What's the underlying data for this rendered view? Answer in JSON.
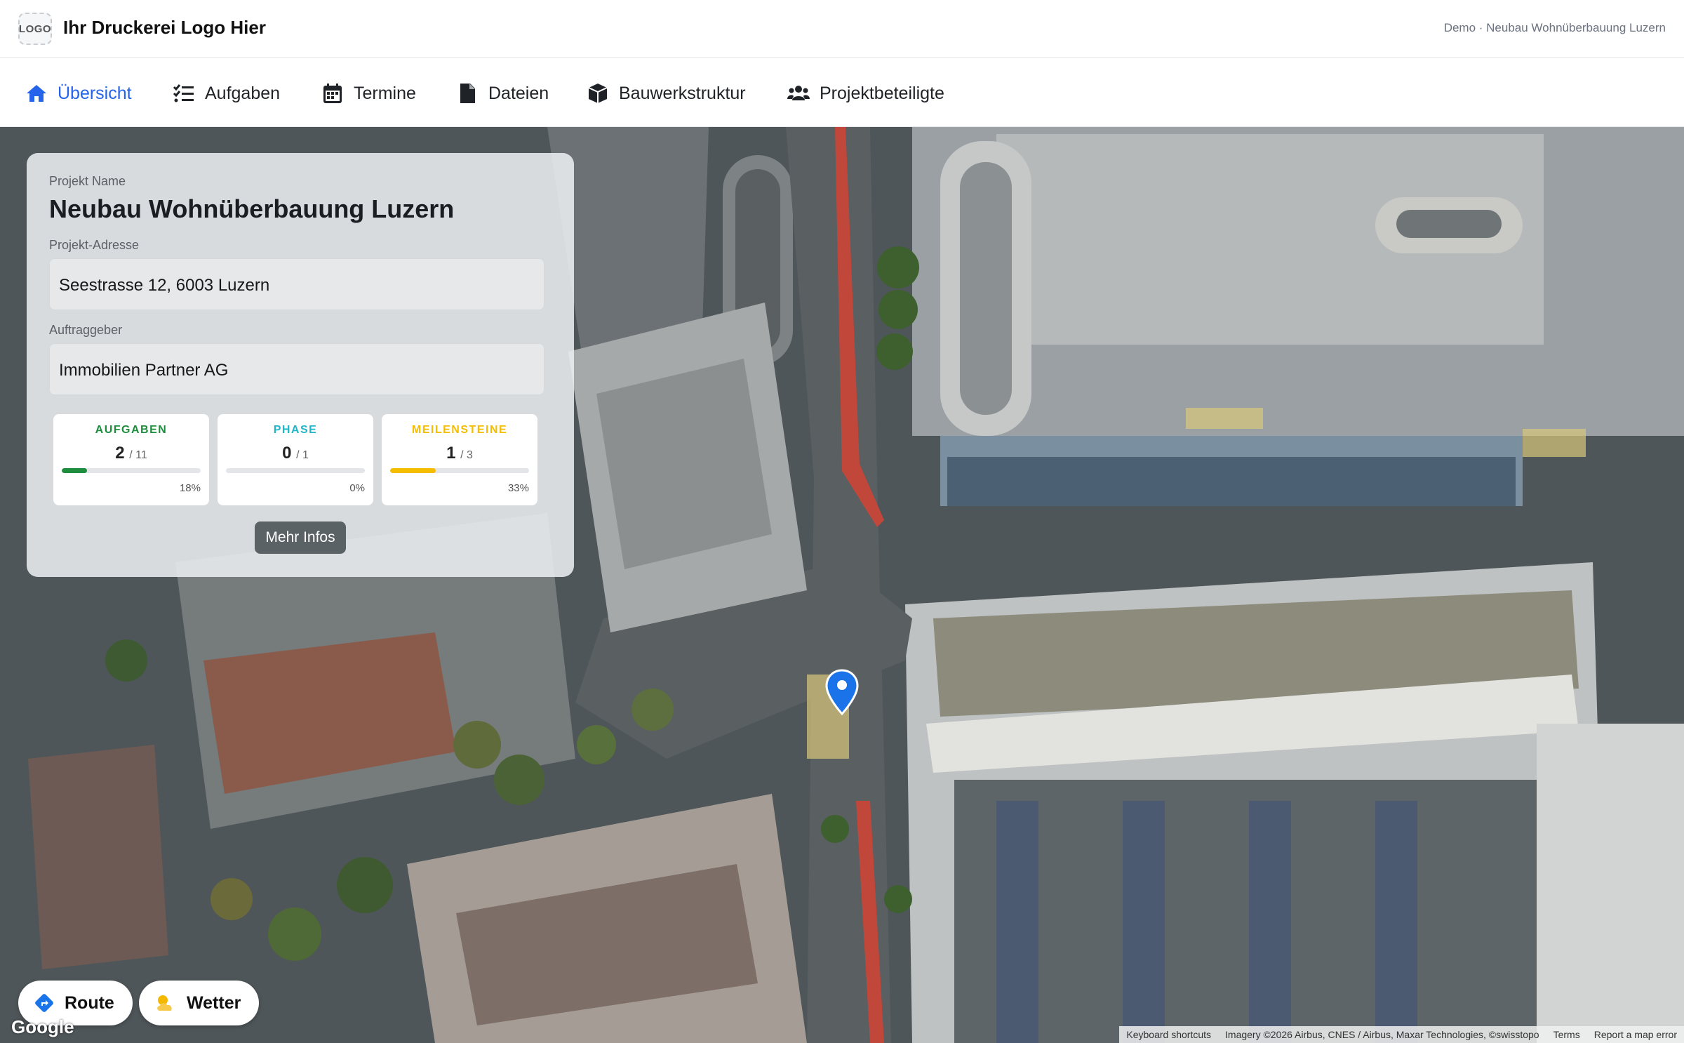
{
  "header": {
    "logo_text": "LOGO",
    "brand": "Ihr Druckerei Logo Hier",
    "context": "Demo · Neubau Wohnüberbauung Luzern"
  },
  "nav": {
    "items": [
      {
        "label": "Übersicht",
        "icon": "home-icon",
        "active": true
      },
      {
        "label": "Aufgaben",
        "icon": "task-list-icon"
      },
      {
        "label": "Termine",
        "icon": "calendar-icon"
      },
      {
        "label": "Dateien",
        "icon": "file-icon"
      },
      {
        "label": "Bauwerkstruktur",
        "icon": "cube-icon"
      },
      {
        "label": "Projektbeteiligte",
        "icon": "users-icon"
      }
    ]
  },
  "project": {
    "name_label": "Projekt Name",
    "name": "Neubau Wohnüberbauung Luzern",
    "address_label": "Projekt-Adresse",
    "address": "Seestrasse 12, 6003 Luzern",
    "client_label": "Auftraggeber",
    "client": "Immobilien Partner AG"
  },
  "stats": [
    {
      "title": "AUFGABEN",
      "value": "2",
      "total": "/ 11",
      "percent": "18%",
      "fraction": 0.18,
      "color": "#1e8e3e"
    },
    {
      "title": "PHASE",
      "value": "0",
      "total": "/ 1",
      "percent": "0%",
      "fraction": 0.0,
      "color": "#1fb6c9"
    },
    {
      "title": "MEILENSTEINE",
      "value": "1",
      "total": "/ 3",
      "percent": "33%",
      "fraction": 0.33,
      "color": "#f5bd02"
    }
  ],
  "more_button": "Mehr Infos",
  "map": {
    "route_button": "Route",
    "weather_button": "Wetter",
    "google_logo": "Google",
    "attribution": {
      "shortcuts": "Keyboard shortcuts",
      "imagery": "Imagery ©2026 Airbus, CNES / Airbus, Maxar Technologies, ©swisstopo",
      "terms": "Terms",
      "report": "Report a map error"
    }
  },
  "colors": {
    "accent": "#2563eb",
    "pin": "#1a73e8"
  }
}
